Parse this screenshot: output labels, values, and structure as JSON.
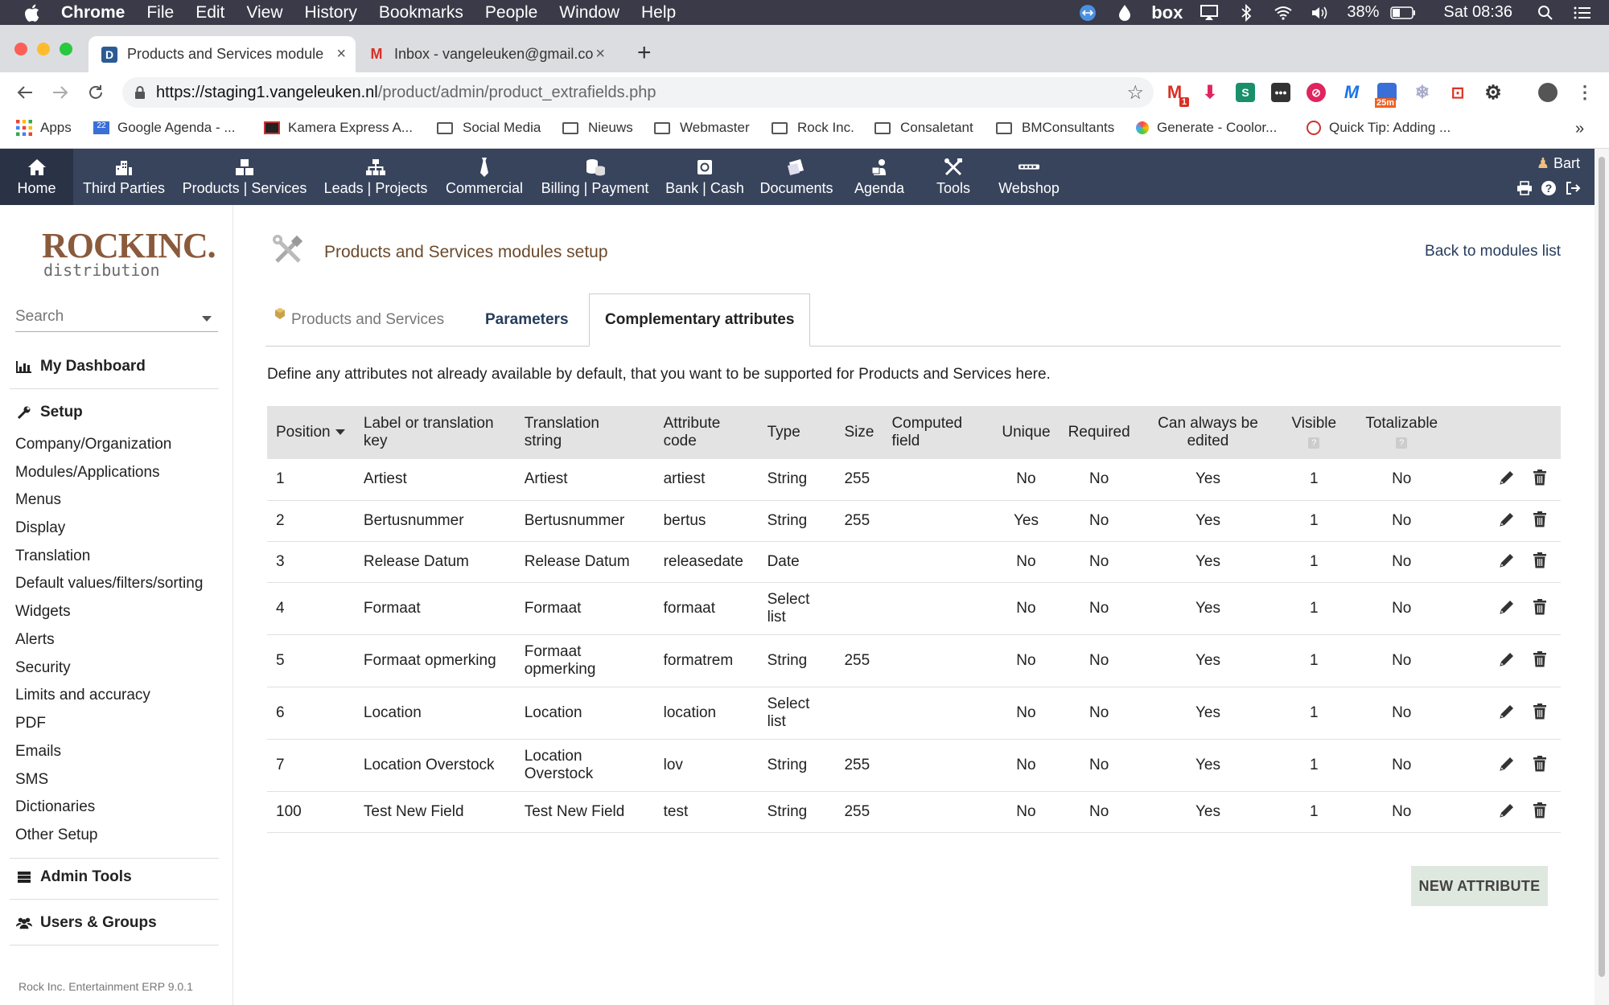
{
  "macos": {
    "menus": [
      "Chrome",
      "File",
      "Edit",
      "View",
      "History",
      "Bookmarks",
      "People",
      "Window",
      "Help"
    ],
    "battery": "38%",
    "clock": "Sat 08:36",
    "box_label": "box"
  },
  "browser": {
    "tabs": [
      {
        "title": "Products and Services module",
        "favicon": "D"
      },
      {
        "title": "Inbox - vangeleuken@gmail.co",
        "favicon": "M"
      }
    ],
    "url_host": "https://staging1.vangeleuken.nl",
    "url_path": "/product/admin/product_extrafields.php",
    "ext_badges": {
      "gmail": "1",
      "calendar": "25m"
    },
    "bookmarks": [
      "Apps",
      "Google Agenda - ...",
      "Kamera Express A...",
      "Social Media",
      "Nieuws",
      "Webmaster",
      "Rock Inc.",
      "Consaletant",
      "BMConsultants",
      "Generate - Coolor...",
      "Quick Tip: Adding ..."
    ],
    "bookmarks_more": "»"
  },
  "app": {
    "nav": [
      {
        "label": "Home",
        "icon": "home-icon"
      },
      {
        "label": "Third Parties",
        "icon": "building-icon"
      },
      {
        "label": "Products | Services",
        "icon": "boxes-icon"
      },
      {
        "label": "Leads | Projects",
        "icon": "sitemap-icon"
      },
      {
        "label": "Commercial",
        "icon": "tie-icon"
      },
      {
        "label": "Billing | Payment",
        "icon": "coins-icon"
      },
      {
        "label": "Bank | Cash",
        "icon": "bank-icon"
      },
      {
        "label": "Documents",
        "icon": "documents-icon"
      },
      {
        "label": "Agenda",
        "icon": "agenda-icon"
      },
      {
        "label": "Tools",
        "icon": "tools-icon"
      },
      {
        "label": "Webshop",
        "icon": "webshop-icon"
      }
    ],
    "user": "Bart",
    "logo_line1": "ROCKINC.",
    "logo_line2": "distribution",
    "search_placeholder": "Search",
    "sidebar": {
      "dashboard": "My Dashboard",
      "setup": "Setup",
      "setup_items": [
        "Company/Organization",
        "Modules/Applications",
        "Menus",
        "Display",
        "Translation",
        "Default values/filters/sorting",
        "Widgets",
        "Alerts",
        "Security",
        "Limits and accuracy",
        "PDF",
        "Emails",
        "SMS",
        "Dictionaries",
        "Other Setup"
      ],
      "admin_tools": "Admin Tools",
      "users_groups": "Users & Groups",
      "version": "Rock Inc. Entertainment ERP 9.0.1"
    }
  },
  "page": {
    "title": "Products and Services modules setup",
    "back_link": "Back to modules list",
    "tabs": [
      "Products and Services",
      "Parameters",
      "Complementary attributes"
    ],
    "description": "Define any attributes not already available by default, that you want to be supported for Products and Services here.",
    "new_button": "NEW ATTRIBUTE"
  },
  "table": {
    "headers": {
      "position": "Position",
      "label": [
        "Label or translation",
        "key"
      ],
      "translation": [
        "Translation",
        "string"
      ],
      "code": [
        "Attribute",
        "code"
      ],
      "type": "Type",
      "size": "Size",
      "computed": [
        "Computed",
        "field"
      ],
      "unique": "Unique",
      "required": "Required",
      "always_edited": [
        "Can always be",
        "edited"
      ],
      "visible": "Visible",
      "totalizable": "Totalizable",
      "help_mark": "?"
    },
    "rows": [
      {
        "pos": "1",
        "label": "Artiest",
        "trans": [
          "Artiest"
        ],
        "code": "artiest",
        "type": [
          "String"
        ],
        "size": "255",
        "computed": "",
        "unique": "No",
        "required": "No",
        "edit": "Yes",
        "visible": "1",
        "total": "No"
      },
      {
        "pos": "2",
        "label": "Bertusnummer",
        "trans": [
          "Bertusnummer"
        ],
        "code": "bertus",
        "type": [
          "String"
        ],
        "size": "255",
        "computed": "",
        "unique": "Yes",
        "required": "No",
        "edit": "Yes",
        "visible": "1",
        "total": "No"
      },
      {
        "pos": "3",
        "label": "Release Datum",
        "trans": [
          "Release Datum"
        ],
        "code": "releasedate",
        "type": [
          "Date"
        ],
        "size": "",
        "computed": "",
        "unique": "No",
        "required": "No",
        "edit": "Yes",
        "visible": "1",
        "total": "No"
      },
      {
        "pos": "4",
        "label": "Formaat",
        "trans": [
          "Formaat"
        ],
        "code": "formaat",
        "type": [
          "Select",
          "list"
        ],
        "size": "",
        "computed": "",
        "unique": "No",
        "required": "No",
        "edit": "Yes",
        "visible": "1",
        "total": "No"
      },
      {
        "pos": "5",
        "label": "Formaat opmerking",
        "trans": [
          "Formaat",
          "opmerking"
        ],
        "code": "formatrem",
        "type": [
          "String"
        ],
        "size": "255",
        "computed": "",
        "unique": "No",
        "required": "No",
        "edit": "Yes",
        "visible": "1",
        "total": "No"
      },
      {
        "pos": "6",
        "label": "Location",
        "trans": [
          "Location"
        ],
        "code": "location",
        "type": [
          "Select",
          "list"
        ],
        "size": "",
        "computed": "",
        "unique": "No",
        "required": "No",
        "edit": "Yes",
        "visible": "1",
        "total": "No"
      },
      {
        "pos": "7",
        "label": "Location Overstock",
        "trans": [
          "Location",
          "Overstock"
        ],
        "code": "lov",
        "type": [
          "String"
        ],
        "size": "255",
        "computed": "",
        "unique": "No",
        "required": "No",
        "edit": "Yes",
        "visible": "1",
        "total": "No"
      },
      {
        "pos": "100",
        "label": "Test New Field",
        "trans": [
          "Test New Field"
        ],
        "code": "test",
        "type": [
          "String"
        ],
        "size": "255",
        "computed": "",
        "unique": "No",
        "required": "No",
        "edit": "Yes",
        "visible": "1",
        "total": "No"
      }
    ]
  },
  "colors": {
    "topnav": "#38445c",
    "accent_link": "#263c5c",
    "title_brown": "#6b4a2b",
    "new_button_bg": "#dfe8de"
  }
}
